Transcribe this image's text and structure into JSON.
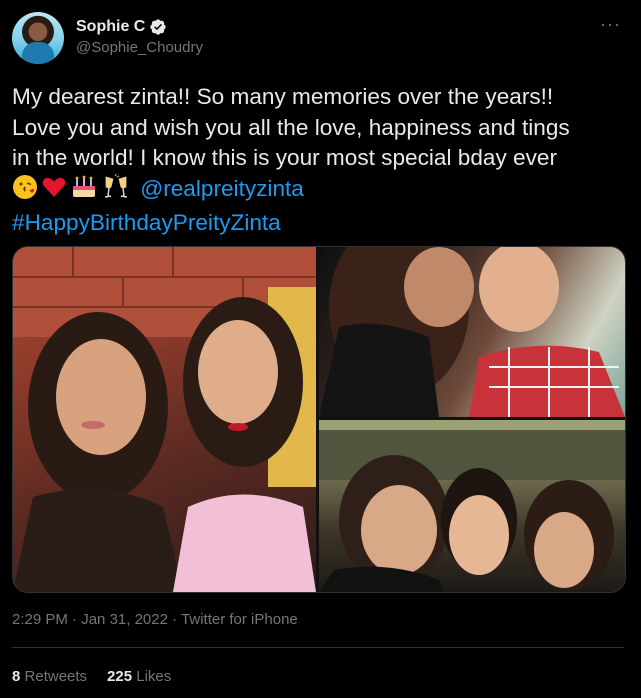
{
  "author": {
    "name": "Sophie C",
    "handle": "@Sophie_Choudry",
    "verified": true
  },
  "more_button": {
    "label": "···"
  },
  "tweet": {
    "lines": [
      "My dearest zinta!! So many memories over the years!!",
      "Love you and wish you all the love, happiness and tings",
      "in the world! I know this is your most special bday ever"
    ],
    "emojis": [
      "kiss-face-emoji",
      "red-heart-emoji",
      "birthday-cake-emoji",
      "champagne-glasses-emoji"
    ],
    "mention": "@realpreityzinta",
    "hashtag": "#HappyBirthdayPreityZinta"
  },
  "media": {
    "count": 3
  },
  "meta": {
    "time": "2:29 PM",
    "date": "Jan 31, 2022",
    "source": "Twitter for iPhone",
    "separator": "·"
  },
  "stats": {
    "retweets_count": "8",
    "retweets_label": "Retweets",
    "likes_count": "225",
    "likes_label": "Likes"
  },
  "colors": {
    "background": "#000000",
    "text": "#e7e9ea",
    "secondary": "#71767b",
    "link": "#1d9bf0",
    "divider": "#2f3336"
  }
}
